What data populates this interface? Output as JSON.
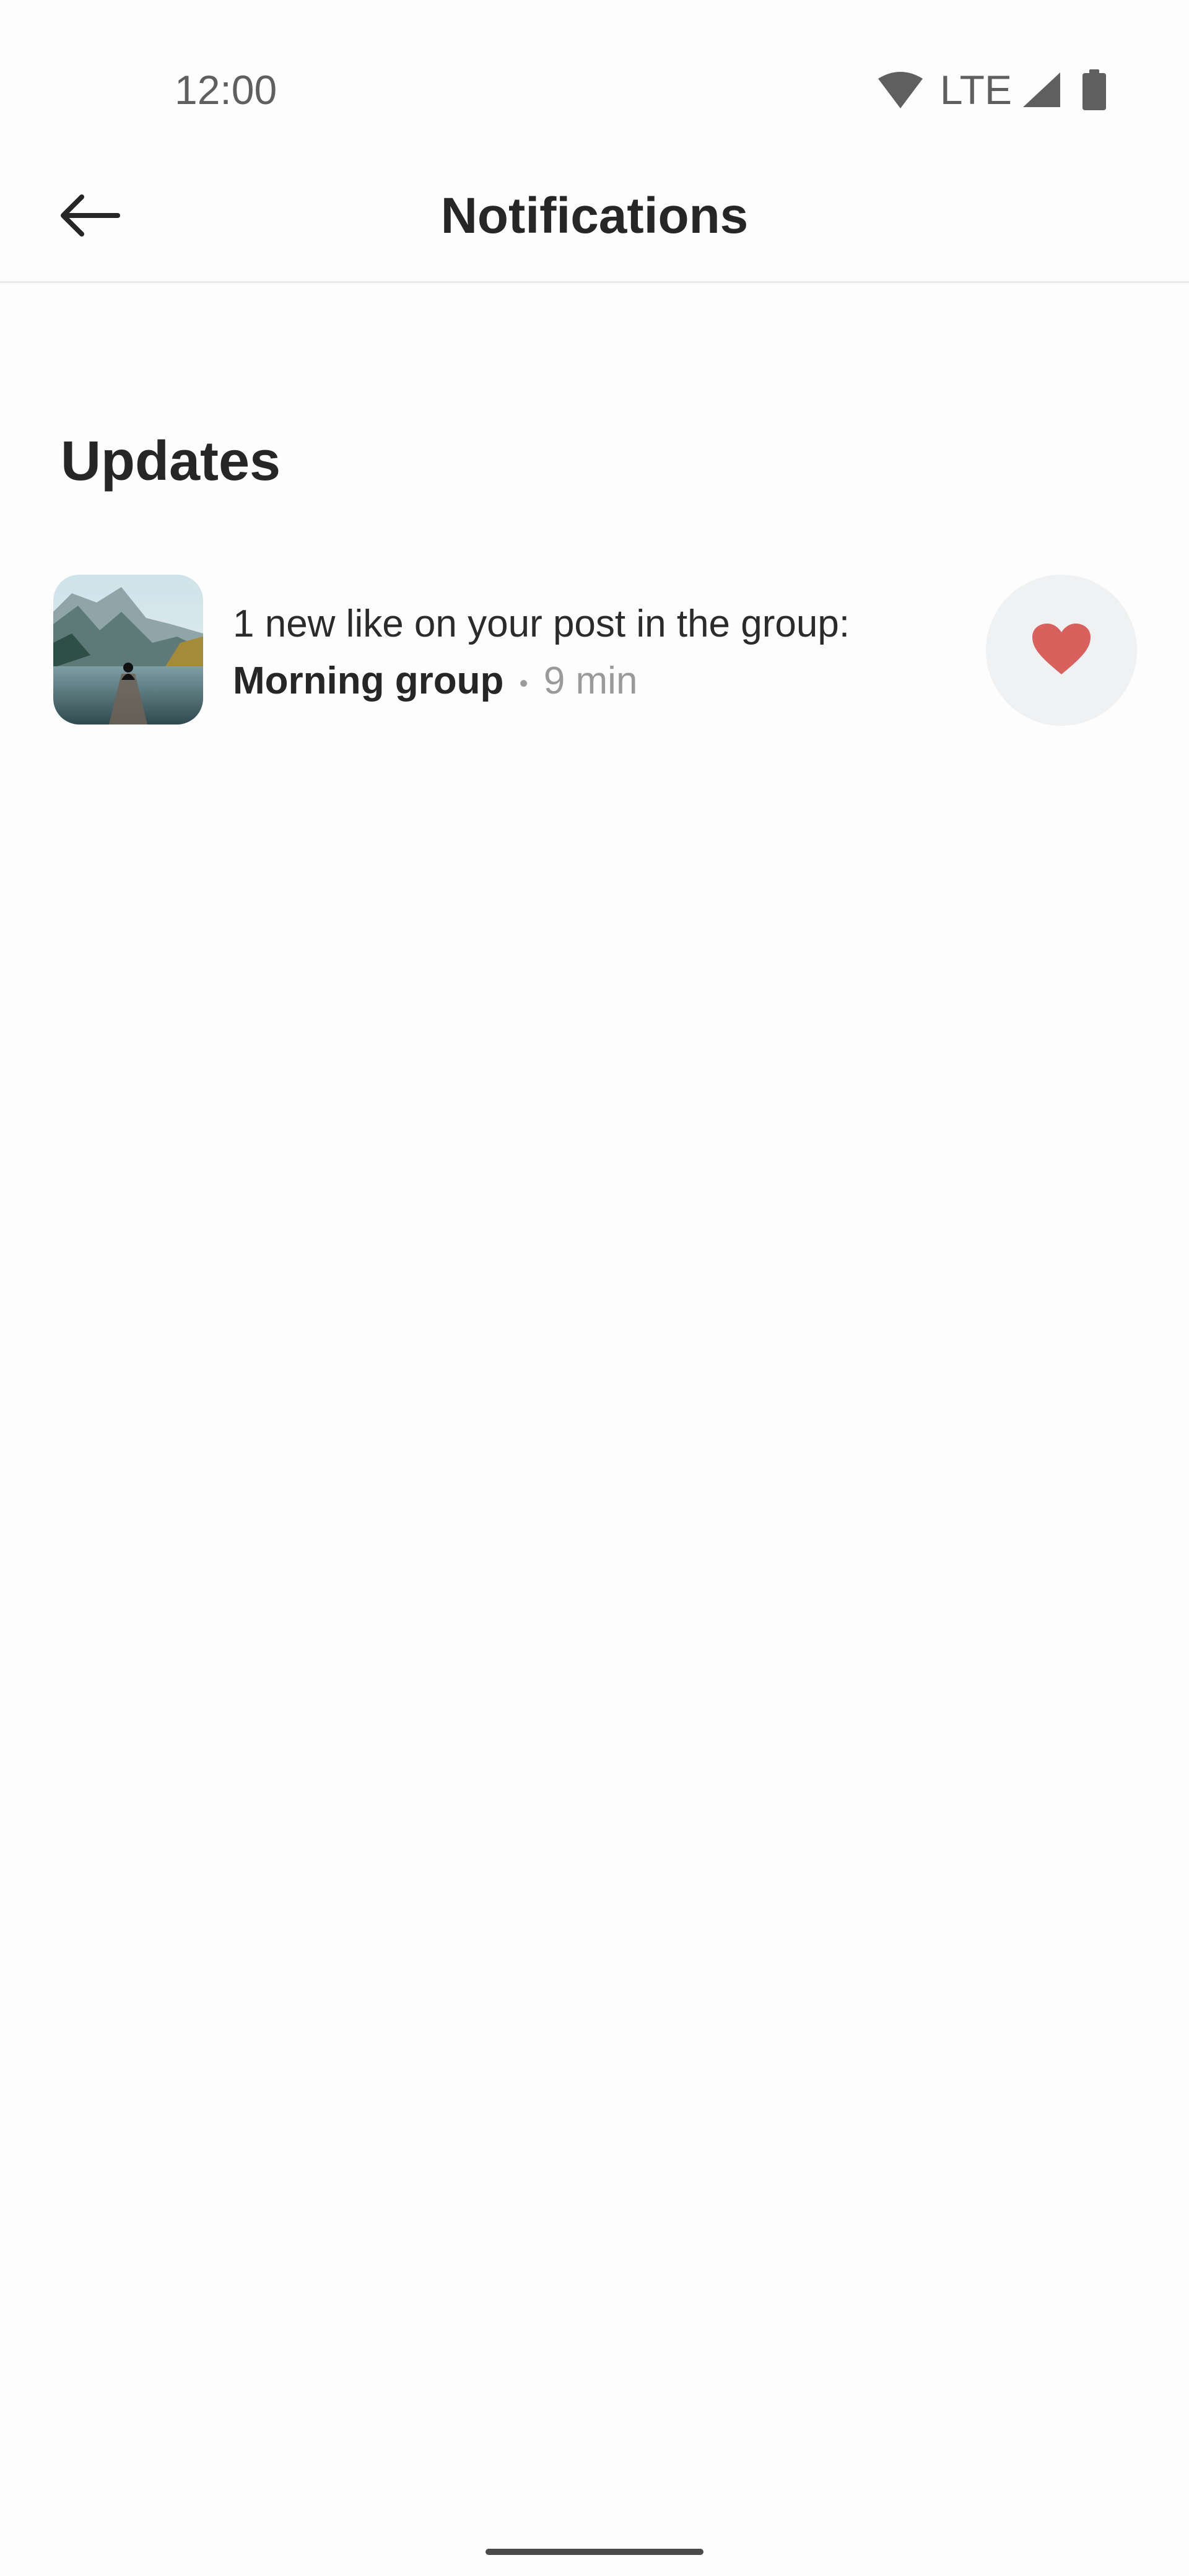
{
  "status_bar": {
    "time": "12:00",
    "network": "LTE",
    "icons": [
      "wifi-icon",
      "cell-signal-icon",
      "battery-icon"
    ]
  },
  "app_bar": {
    "title": "Notifications",
    "back_icon": "arrow-left-icon"
  },
  "section": {
    "heading": "Updates"
  },
  "notifications": [
    {
      "message": "1 new like on your post in the group:",
      "group": "Morning group",
      "separator": "•",
      "time_ago": "9 min",
      "thumbnail": "lake-mountains-photo",
      "action_icon": "heart-icon"
    }
  ],
  "colors": {
    "heart": "#d8615d",
    "like_button_bg": "#eff1f2",
    "muted_text": "#9a9a9a",
    "primary_text": "#262626"
  }
}
